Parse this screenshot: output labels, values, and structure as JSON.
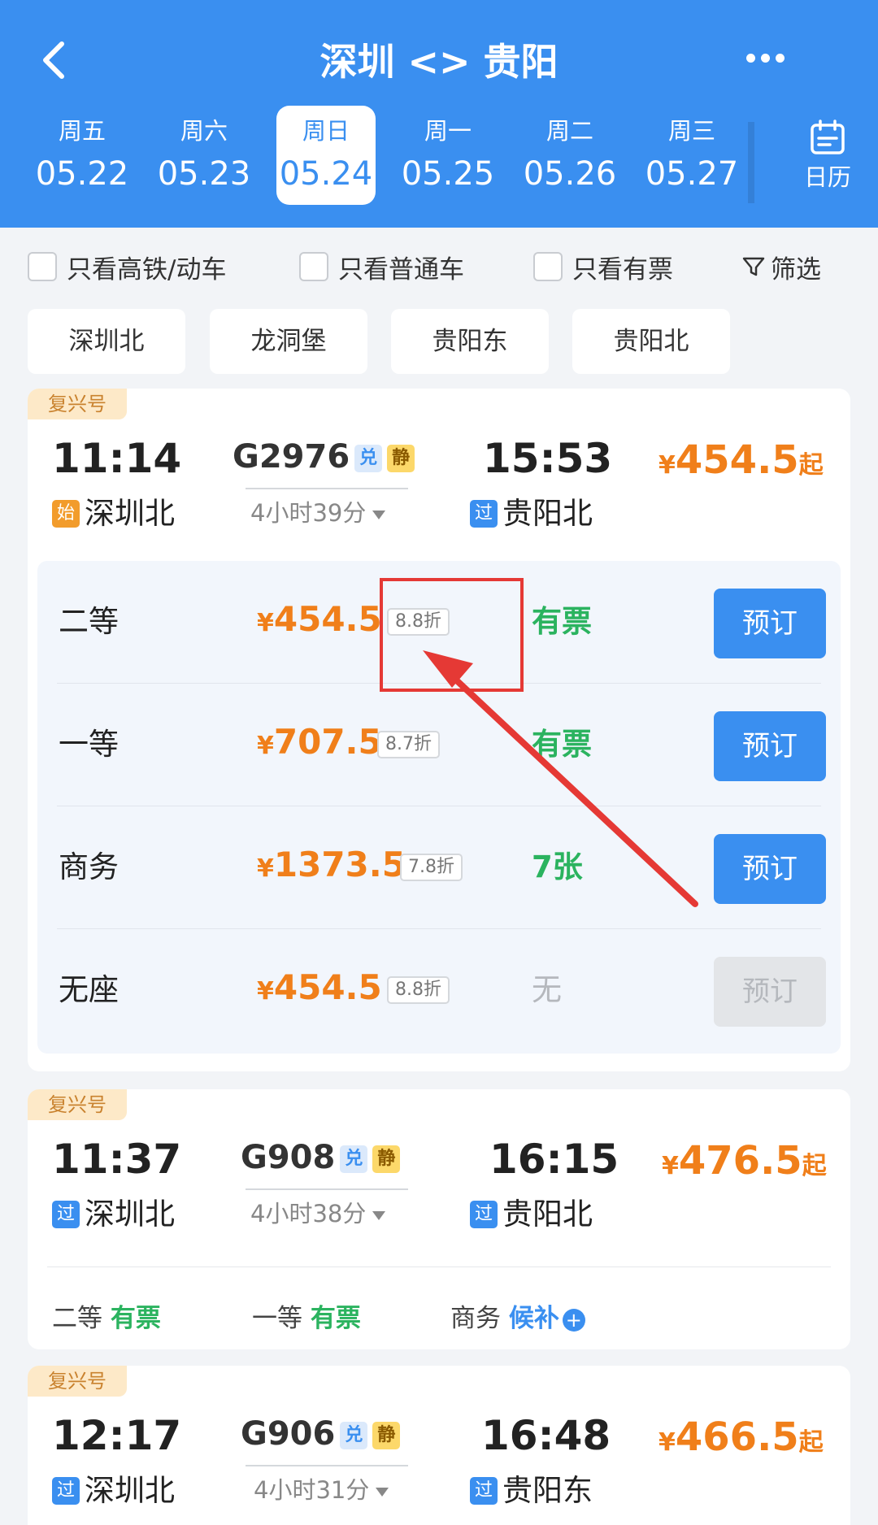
{
  "header": {
    "title": "深圳 <> 贵阳",
    "dates": [
      {
        "dow": "周五",
        "date": "05.22"
      },
      {
        "dow": "周六",
        "date": "05.23"
      },
      {
        "dow": "周日",
        "date": "05.24",
        "selected": true
      },
      {
        "dow": "周一",
        "date": "05.25"
      },
      {
        "dow": "周二",
        "date": "05.26"
      },
      {
        "dow": "周三",
        "date": "05.27"
      }
    ],
    "calendar_label": "日历"
  },
  "filters": {
    "high_speed_only": "只看高铁/动车",
    "regular_only": "只看普通车",
    "available_only": "只看有票",
    "filter_label": "筛选"
  },
  "stations": [
    "深圳北",
    "龙洞堡",
    "贵阳东",
    "贵阳北"
  ],
  "trains": [
    {
      "type": "复兴号",
      "depart_time": "11:14",
      "train_no": "G2976",
      "badges": [
        "兑",
        "静"
      ],
      "arrive_time": "15:53",
      "duration": "4小时39分",
      "from_badge": "始",
      "from_station": "深圳北",
      "to_badge": "过",
      "to_station": "贵阳北",
      "price_yen": "¥",
      "price": "454.5",
      "price_suffix": "起",
      "seats": [
        {
          "name": "二等",
          "yen": "¥",
          "price": "454.5",
          "discount": "8.8折",
          "availability": "有票",
          "book": "预订"
        },
        {
          "name": "一等",
          "yen": "¥",
          "price": "707.5",
          "discount": "8.7折",
          "availability": "有票",
          "book": "预订"
        },
        {
          "name": "商务",
          "yen": "¥",
          "price": "1373.5",
          "discount": "7.8折",
          "availability": "7张",
          "book": "预订"
        },
        {
          "name": "无座",
          "yen": "¥",
          "price": "454.5",
          "discount": "8.8折",
          "availability": "无",
          "book": "预订"
        }
      ]
    },
    {
      "type": "复兴号",
      "depart_time": "11:37",
      "train_no": "G908",
      "badges": [
        "兑",
        "静"
      ],
      "arrive_time": "16:15",
      "duration": "4小时38分",
      "from_badge": "过",
      "from_station": "深圳北",
      "to_badge": "过",
      "to_station": "贵阳北",
      "price_yen": "¥",
      "price": "476.5",
      "price_suffix": "起",
      "summary": [
        {
          "seat": "二等",
          "status": "有票"
        },
        {
          "seat": "一等",
          "status": "有票"
        },
        {
          "seat": "商务",
          "status": "候补"
        }
      ]
    },
    {
      "type": "复兴号",
      "depart_time": "12:17",
      "train_no": "G906",
      "badges": [
        "兑",
        "静"
      ],
      "arrive_time": "16:48",
      "duration": "4小时31分",
      "from_badge": "过",
      "from_station": "深圳北",
      "to_badge": "过",
      "to_station": "贵阳东",
      "price_yen": "¥",
      "price": "466.5",
      "price_suffix": "起"
    }
  ],
  "colors": {
    "primary": "#3a8ff0",
    "price": "#f07f1a",
    "available": "#2bb35f",
    "annotation": "#e53935"
  },
  "icons": {
    "back": "chevron-left-icon",
    "more": "more-dots-icon",
    "calendar": "calendar-icon",
    "filter": "funnel-icon",
    "dropdown": "caret-down-icon",
    "plus": "plus-circle-icon"
  }
}
